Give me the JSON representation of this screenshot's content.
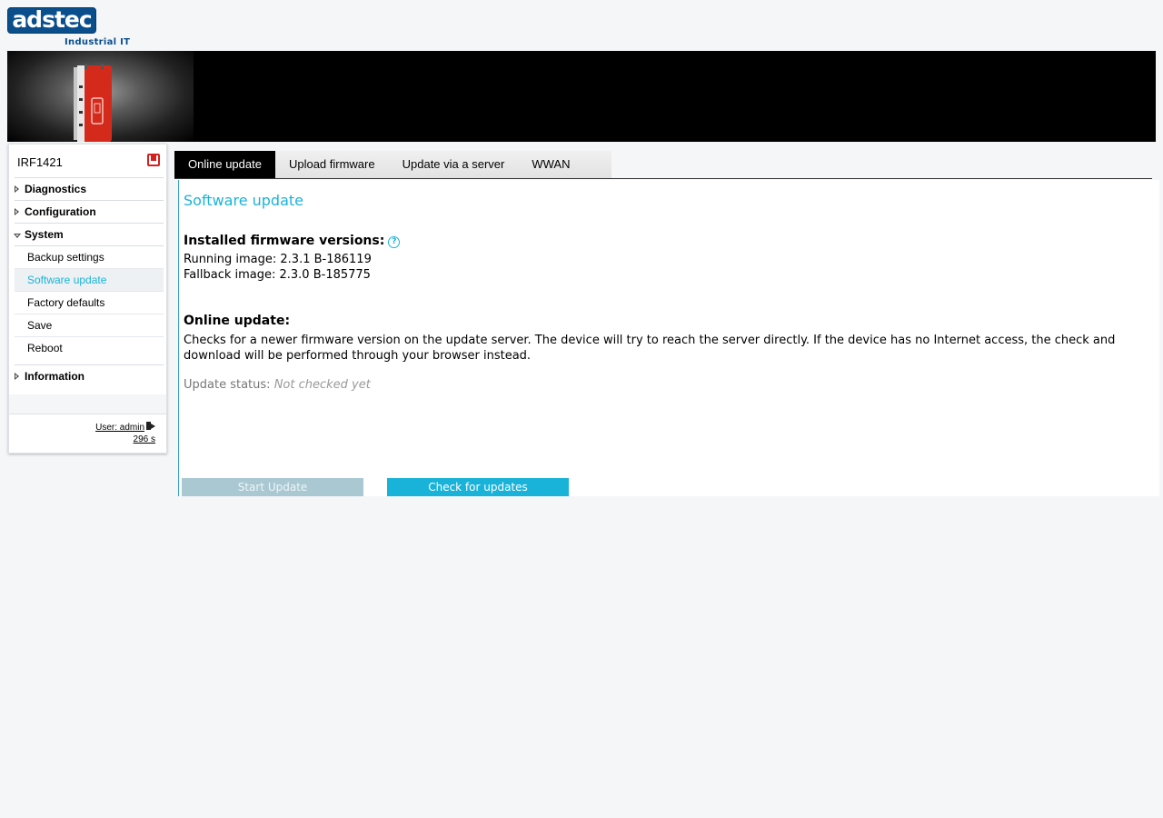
{
  "logo": {
    "text": "adstec",
    "subtitle": "Industrial IT"
  },
  "sidebar": {
    "device_name": "IRF1421",
    "menu": {
      "diagnostics": "Diagnostics",
      "configuration": "Configuration",
      "system": "System",
      "system_items": [
        "Backup settings",
        "Software update",
        "Factory defaults",
        "Save",
        "Reboot"
      ],
      "information": "Information"
    },
    "user": "User: admin",
    "timer": "296 s"
  },
  "tabs": [
    "Online update",
    "Upload firmware",
    "Update via a server",
    "WWAN"
  ],
  "content": {
    "title": "Software update",
    "installed_heading": "Installed firmware versions:",
    "running_image": "Running image: 2.3.1 B-186119",
    "fallback_image": "Fallback image: 2.3.0 B-185775",
    "online_heading": "Online update:",
    "online_description": "Checks for a newer firmware version on the update server. The device will try to reach the server directly. If the device has no Internet access, the check and download will be performed through your browser instead.",
    "status_label": "Update status:",
    "status_value": "Not checked yet",
    "start_button": "Start Update",
    "check_button": "Check for updates"
  },
  "colors": {
    "accent": "#19b3d9",
    "brand": "#0a4f8c",
    "disabled_button": "#a9c8d2"
  },
  "icons": {
    "save": "save-icon",
    "help": "help-icon",
    "logout": "logout-icon"
  }
}
